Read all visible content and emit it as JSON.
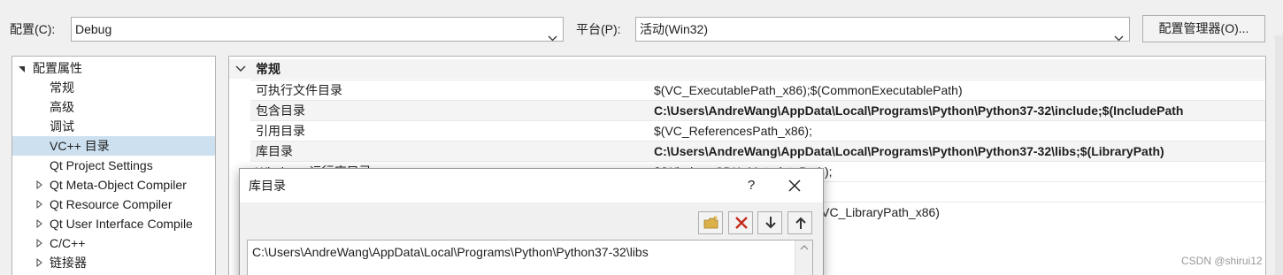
{
  "toolbar": {
    "config_label": "配置(C):",
    "config_value": "Debug",
    "platform_label": "平台(P):",
    "platform_value": "活动(Win32)",
    "config_manager_label": "配置管理器(O)..."
  },
  "tree": {
    "root_label": "配置属性",
    "items": [
      {
        "label": "常规",
        "expandable": false,
        "selected": false
      },
      {
        "label": "高级",
        "expandable": false,
        "selected": false
      },
      {
        "label": "调试",
        "expandable": false,
        "selected": false
      },
      {
        "label": "VC++ 目录",
        "expandable": false,
        "selected": true
      },
      {
        "label": "Qt Project Settings",
        "expandable": false,
        "selected": false
      },
      {
        "label": "Qt Meta-Object Compiler",
        "expandable": true,
        "selected": false
      },
      {
        "label": "Qt Resource Compiler",
        "expandable": true,
        "selected": false
      },
      {
        "label": "Qt User Interface Compile",
        "expandable": true,
        "selected": false
      },
      {
        "label": "C/C++",
        "expandable": true,
        "selected": false
      },
      {
        "label": "链接器",
        "expandable": true,
        "selected": false
      }
    ]
  },
  "grid": {
    "section_label": "常规",
    "rows": [
      {
        "name": "可执行文件目录",
        "value": "$(VC_ExecutablePath_x86);$(CommonExecutablePath)",
        "bold": false
      },
      {
        "name": "包含目录",
        "value": "C:\\Users\\AndreWang\\AppData\\Local\\Programs\\Python\\Python37-32\\include;$(IncludePath",
        "bold": true
      },
      {
        "name": "引用目录",
        "value": "$(VC_ReferencesPath_x86);",
        "bold": false
      },
      {
        "name": "库目录",
        "value": "C:\\Users\\AndreWang\\AppData\\Local\\Programs\\Python\\Python37-32\\libs;$(LibraryPath)",
        "bold": true
      },
      {
        "name": "Windows 运行库目录",
        "value": "$(WindowsSDK_MetadataPath);",
        "bold": false
      },
      {
        "name": "",
        "value": "",
        "bold": false
      },
      {
        "name": "",
        "value": "$(VC_ExecutablePath_x86);$(VC_LibraryPath_x86)",
        "bold": false
      }
    ]
  },
  "dialog": {
    "title": "库目录",
    "help_label": "?",
    "list_items": [
      "C:\\Users\\AndreWang\\AppData\\Local\\Programs\\Python\\Python37-32\\libs"
    ]
  },
  "watermark": "CSDN @shirui12",
  "icons": {
    "chevron": "chevron-down-icon",
    "tree_collapse": "collapse-triangle-icon",
    "tree_expand": "expand-triangle-icon",
    "grid_section": "section-chevron-icon",
    "new_line": "new-folder-icon",
    "delete": "delete-icon",
    "move_down": "arrow-down-icon",
    "move_up": "arrow-up-icon",
    "close": "close-icon"
  },
  "colors": {
    "selection": "#cce0f0",
    "delete_red": "#c42b1c",
    "folder_yellow": "#dcb14a"
  }
}
